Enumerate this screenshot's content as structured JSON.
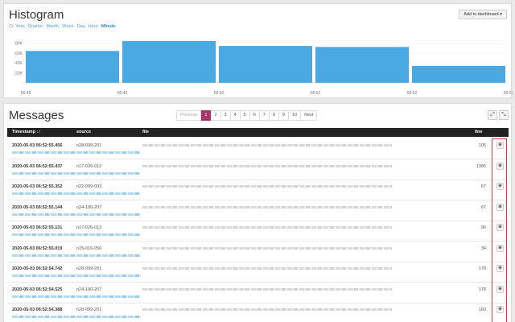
{
  "histogram": {
    "title": "Histogram",
    "granularity": [
      "Year,",
      "Quarter,",
      "Month,",
      "Week,",
      "Day,",
      "Hour,"
    ],
    "granularity_selected": "Minute",
    "add_button": "Add to dashboard ▾"
  },
  "chart_data": {
    "type": "bar",
    "categories": [
      "06:48",
      "06:49",
      "06:50",
      "06:51",
      "06:52"
    ],
    "values": [
      64000,
      84000,
      74000,
      72000,
      34000
    ],
    "x_tick_labels": [
      "06:48",
      "06:49",
      "06:50",
      "06:51",
      "06:52",
      "06:53"
    ],
    "y_tick_labels": [
      "80K",
      "60K",
      "40K",
      "20K"
    ],
    "ylim": [
      0,
      100000
    ],
    "bar_color": "#4aa9e2",
    "title": "",
    "xlabel": "",
    "ylabel": ""
  },
  "messages": {
    "title": "Messages",
    "pagination": [
      "Previous",
      "1",
      "2",
      "3",
      "4",
      "5",
      "6",
      "7",
      "8",
      "9",
      "10",
      "Next"
    ],
    "active_page": "1",
    "columns": {
      "timestamp": "Timestamp ↓↑",
      "source": "source",
      "file": "file",
      "line": "line"
    },
    "rows": [
      {
        "ts": "2020-05-03 06:52:55.456",
        "src": "n28-099-201",
        "line": "105"
      },
      {
        "ts": "2020-05-03 06:52:55.437",
        "src": "n17-026-012",
        "line": "1385"
      },
      {
        "ts": "2020-05-03 06:52:55.352",
        "src": "n22-099-003",
        "line": "67"
      },
      {
        "ts": "2020-05-03 06:52:55.144",
        "src": "n24-100-207",
        "line": "67"
      },
      {
        "ts": "2020-05-03 06:52:55.131",
        "src": "n17-026-012",
        "line": "96"
      },
      {
        "ts": "2020-05-03 06:52:55.019",
        "src": "n15-016-056",
        "line": "34"
      },
      {
        "ts": "2020-05-03 06:52:54.742",
        "src": "n28-099-201",
        "line": "178"
      },
      {
        "ts": "2020-05-03 06:52:54.525",
        "src": "n24-100-207",
        "line": "178"
      },
      {
        "ts": "2020-05-03 06:52:54.388",
        "src": "n28-099-201",
        "line": "160"
      }
    ]
  }
}
